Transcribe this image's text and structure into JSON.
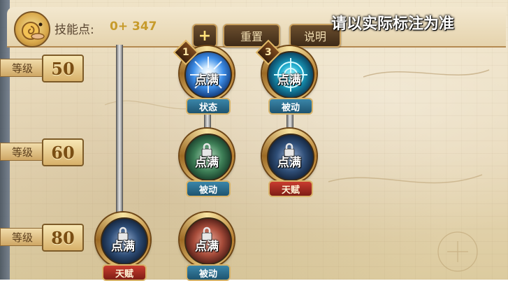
{
  "header": {
    "skill_points_label": "技能点:",
    "skill_points_value": "0+ 347",
    "plus_button": "+",
    "reset_button": "重置",
    "help_button": "说明"
  },
  "overlay_notice": "请以实际标注为准",
  "levels": [
    {
      "tag": "等级",
      "value": "50"
    },
    {
      "tag": "等级",
      "value": "60"
    },
    {
      "tag": "等级",
      "value": "80"
    }
  ],
  "skills": [
    {
      "rank": "1",
      "status": "点满",
      "type": "状态",
      "icon": "blue-burst-icon",
      "locked": false
    },
    {
      "rank": "3",
      "status": "点满",
      "type": "被动",
      "icon": "crosshair-target-icon",
      "locked": false
    },
    {
      "rank": "",
      "status": "点满",
      "type": "被动",
      "icon": "green-lock-icon",
      "locked": true
    },
    {
      "rank": "",
      "status": "点满",
      "type": "天赋",
      "icon": "navy-lock-icon",
      "locked": true
    },
    {
      "rank": "",
      "status": "点满",
      "type": "天赋",
      "icon": "navy-lock-icon",
      "locked": true
    },
    {
      "rank": "",
      "status": "点满",
      "type": "被动",
      "icon": "red-lock-icon",
      "locked": true
    }
  ],
  "colors": {
    "accent_gold": "#c79b2b",
    "tag_blue": "#1e5470",
    "tag_red": "#7e1d15"
  }
}
